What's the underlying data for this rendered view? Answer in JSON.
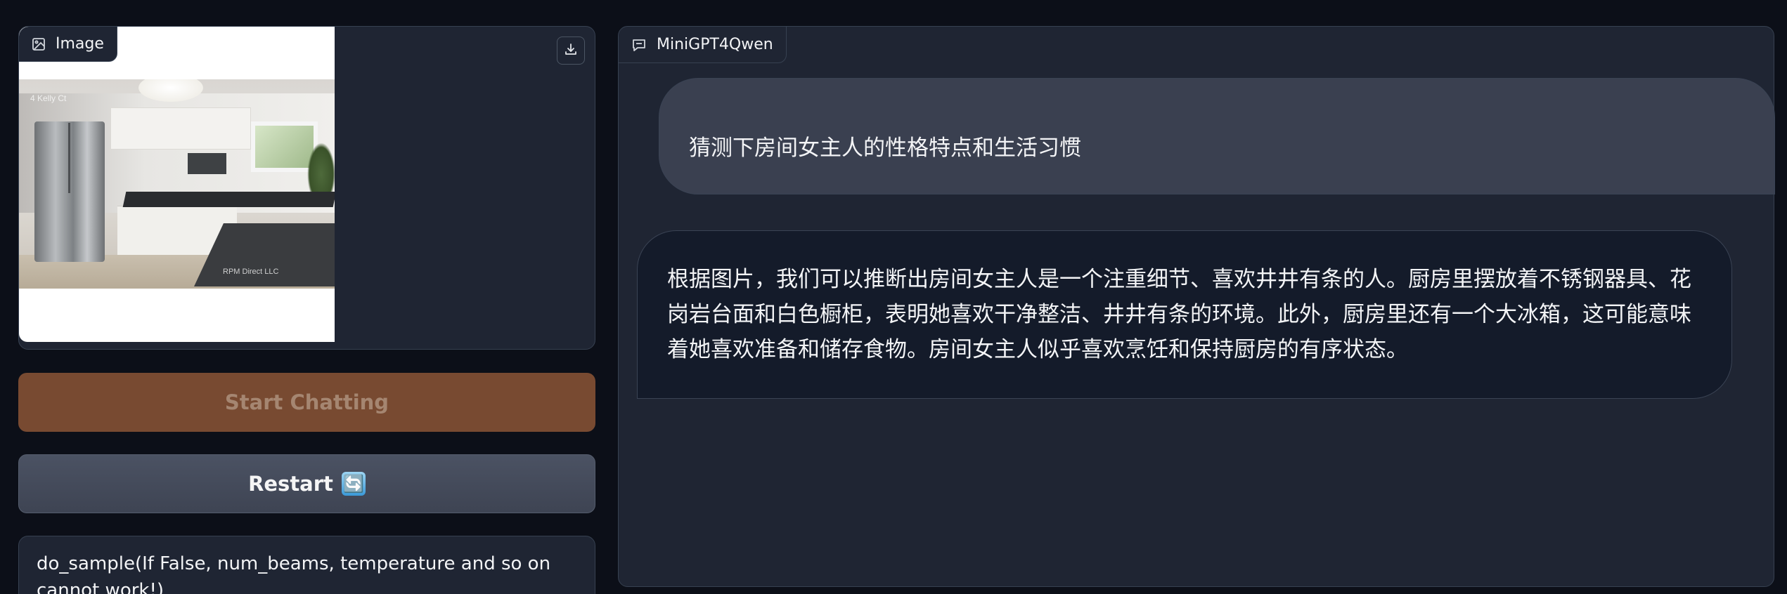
{
  "image_panel": {
    "label": "Image",
    "label_icon": "image-icon",
    "download_icon": "download-icon",
    "photo_watermark_top": "4 Kelly Ct",
    "photo_watermark_bottom": "RPM Direct LLC"
  },
  "buttons": {
    "start_label": "Start Chatting",
    "restart_label": "Restart",
    "restart_icon": "🔄"
  },
  "sample_box": {
    "text": "do_sample(If False, num_beams, temperature and so on cannot work!)"
  },
  "chat_panel": {
    "label": "MiniGPT4Qwen",
    "label_icon": "chat-icon",
    "messages": [
      {
        "role": "user",
        "text": "猜测下房间女主人的性格特点和生活习惯"
      },
      {
        "role": "bot",
        "text": "根据图片，我们可以推断出房间女主人是一个注重细节、喜欢井井有条的人。厨房里摆放着不锈钢器具、花岗岩台面和白色橱柜，表明她喜欢干净整洁、井井有条的环境。此外，厨房里还有一个大冰箱，这可能意味着她喜欢准备和储存食物。房间女主人似乎喜欢烹饪和保持厨房的有序状态。"
      }
    ]
  },
  "colors": {
    "background": "#0c0f18",
    "panel": "#1f2533",
    "start_button": "#784a31",
    "user_bubble": "#3a4050",
    "bot_bubble": "#141b2a"
  }
}
